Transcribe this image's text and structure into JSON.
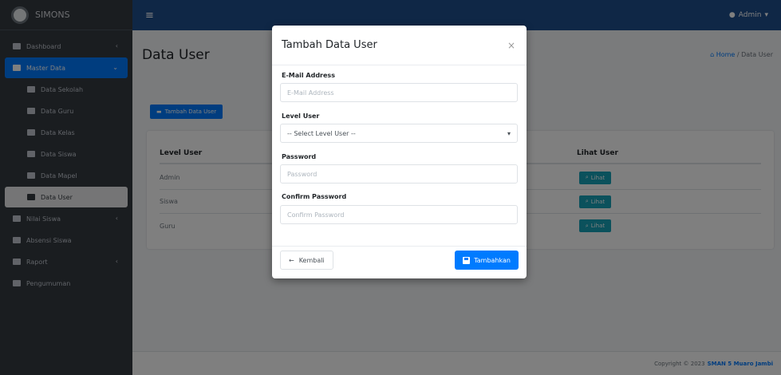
{
  "app": {
    "brand": "SIMONS"
  },
  "header": {
    "menu_icon": "hamburger-icon",
    "user": "Admin"
  },
  "sidebar": {
    "items": [
      {
        "label": "Dashboard",
        "icon": "home-icon",
        "has_arrow": true
      },
      {
        "label": "Master Data",
        "icon": "edit-icon",
        "has_arrow": true,
        "active": true
      },
      {
        "label": "Data Sekolah",
        "icon": "table-icon",
        "sub": true
      },
      {
        "label": "Data Guru",
        "icon": "users-icon",
        "sub": true
      },
      {
        "label": "Data Kelas",
        "icon": "building-icon",
        "sub": true
      },
      {
        "label": "Data Siswa",
        "icon": "users-icon",
        "sub": true
      },
      {
        "label": "Data Mapel",
        "icon": "table-icon",
        "sub": true
      },
      {
        "label": "Data User",
        "icon": "user-plus-icon",
        "sub": true,
        "current": true
      },
      {
        "label": "Nilai Siswa",
        "icon": "bell-icon",
        "has_arrow": true
      },
      {
        "label": "Absensi Siswa",
        "icon": "calendar-icon"
      },
      {
        "label": "Raport",
        "icon": "book-icon",
        "has_arrow": true
      },
      {
        "label": "Pengumuman",
        "icon": "file-icon"
      }
    ]
  },
  "page": {
    "title": "Data User",
    "breadcrumb": {
      "home": "Home",
      "current": "Data User"
    },
    "add_button": "Tambah Data User"
  },
  "table": {
    "headers": {
      "level": "Level User",
      "lihat": "Lihat User"
    },
    "rows": [
      {
        "level": "Admin",
        "action": "Lihat"
      },
      {
        "level": "Siswa",
        "action": "Lihat"
      },
      {
        "level": "Guru",
        "action": "Lihat"
      }
    ]
  },
  "footer": {
    "text": "Copyright © 2023",
    "link": "SMAN 5 Muaro Jambi"
  },
  "modal": {
    "title": "Tambah Data User",
    "close": "×",
    "email_label": "E-Mail Address",
    "email_placeholder": "E-Mail Address",
    "level_label": "Level User",
    "level_selected": "-- Select Level User --",
    "password_label": "Password",
    "password_placeholder": "Password",
    "confirm_label": "Confirm Password",
    "confirm_placeholder": "Confirm Password",
    "back_button": "Kembali",
    "submit_button": "Tambahkan"
  }
}
